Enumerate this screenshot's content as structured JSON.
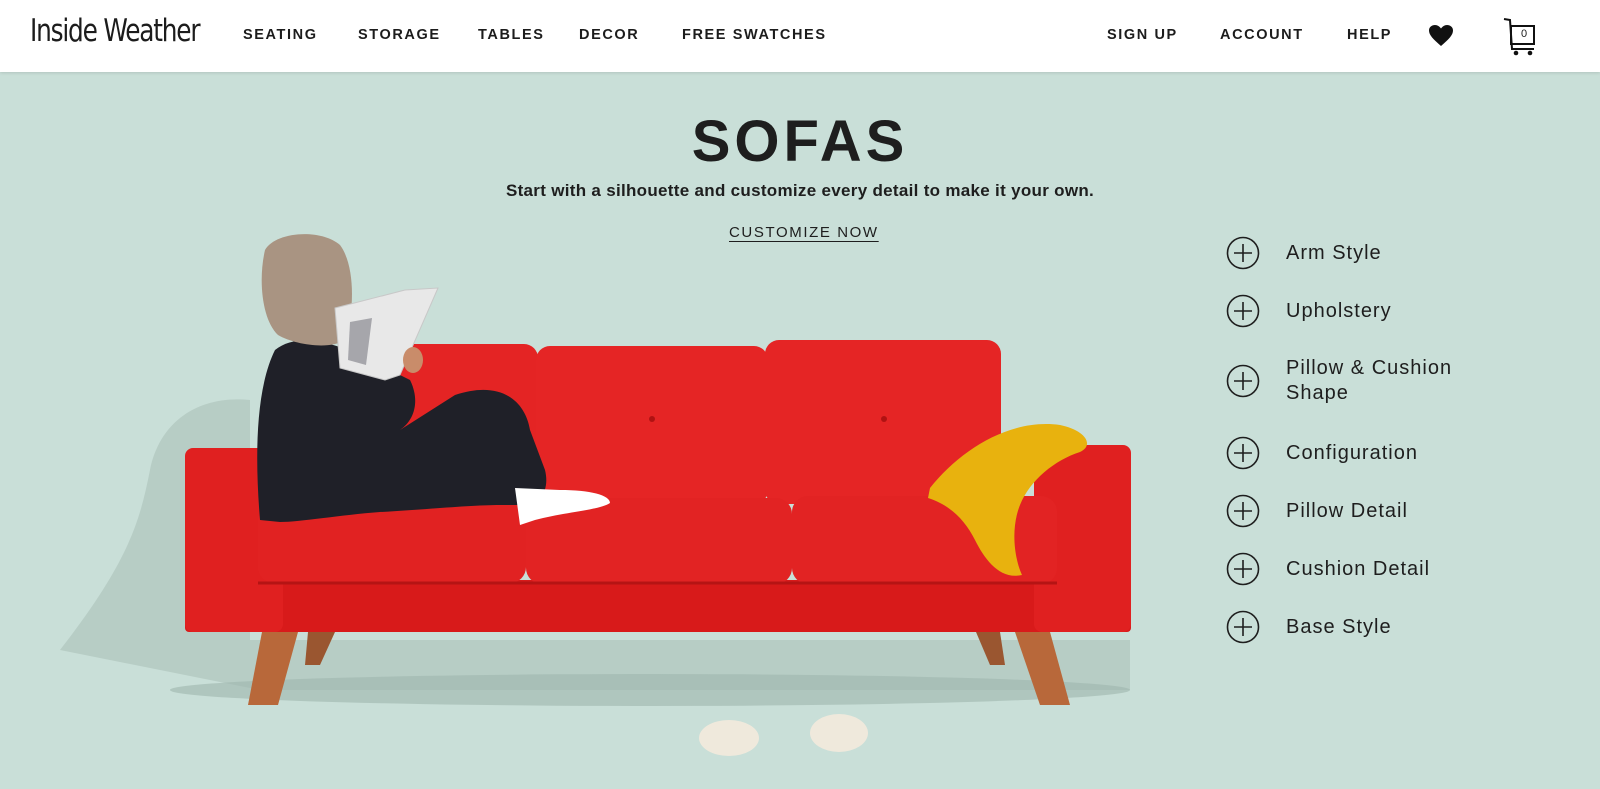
{
  "header": {
    "logo": "Inside Weather",
    "nav": {
      "seating": "SEATING",
      "storage": "STORAGE",
      "tables": "TABLES",
      "decor": "DECOR",
      "swatches": "FREE SWATCHES"
    },
    "account_nav": {
      "signup": "SIGN UP",
      "account": "ACCOUNT",
      "help": "HELP"
    },
    "cart_count": "0",
    "icons": [
      "heart-icon",
      "cart-icon"
    ]
  },
  "hero": {
    "title": "SOFAS",
    "subtitle": "Start with a silhouette and customize every detail to make it your own.",
    "cta": "CUSTOMIZE NOW"
  },
  "options": [
    {
      "label": "Arm Style"
    },
    {
      "label": "Upholstery"
    },
    {
      "label": "Pillow & Cushion Shape"
    },
    {
      "label": "Configuration"
    },
    {
      "label": "Pillow Detail"
    },
    {
      "label": "Cushion Detail"
    },
    {
      "label": "Base Style"
    }
  ],
  "colors": {
    "background": "#c9dfd8",
    "sofa": "#e01e1e",
    "legs": "#b8683a",
    "throw": "#e8b20e",
    "text": "#1e1e1e"
  }
}
